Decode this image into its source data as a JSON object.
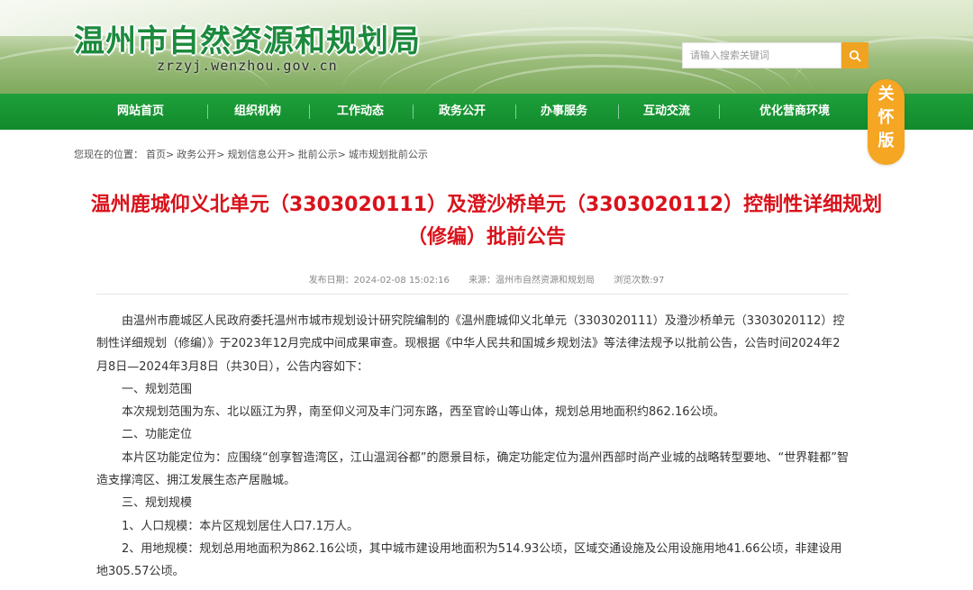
{
  "site": {
    "title": "温州市自然资源和规划局",
    "url": "zrzyj.wenzhou.gov.cn"
  },
  "search": {
    "placeholder": "请输入搜索关键词",
    "icon": "search-icon"
  },
  "nav": {
    "items": [
      "网站首页",
      "组织机构",
      "工作动态",
      "政务公开",
      "办事服务",
      "互动交流",
      "优化营商环境"
    ]
  },
  "care_mode": {
    "chars": [
      "关",
      "怀",
      "版"
    ]
  },
  "breadcrumb": {
    "prefix": "您现在的位置：",
    "items": [
      "首页>",
      "政务公开>",
      "规划信息公开>",
      "批前公示>",
      "城市规划批前公示"
    ]
  },
  "article": {
    "title": "温州鹿城仰义北单元（3303020111）及澄沙桥单元（3303020112）控制性详细规划（修编）批前公告",
    "meta": {
      "date": "发布日期：2024-02-08 15:02:16",
      "source": "来源：温州市自然资源和规划局",
      "views": "浏览次数:97"
    },
    "paragraphs": [
      "由温州市鹿城区人民政府委托温州市城市规划设计研究院编制的《温州鹿城仰义北单元（3303020111）及澄沙桥单元（3303020112）控制性详细规划（修编）》于2023年12月完成中间成果审查。现根据《中华人民共和国城乡规划法》等法律法规予以批前公告，公告时间2024年2月8日—2024年3月8日（共30日），公告内容如下：",
      "一、规划范围",
      "本次规划范围为东、北以瓯江为界，南至仰义河及丰门河东路，西至官岭山等山体，规划总用地面积约862.16公顷。",
      "二、功能定位",
      "本片区功能定位为：应围绕“创享智造湾区，江山温润谷都”的愿景目标，确定功能定位为温州西部时尚产业城的战略转型要地、“世界鞋都”智造支撑湾区、拥江发展生态产居融城。",
      "三、规划规模",
      "1、人口规模：本片区规划居住人口7.1万人。",
      "2、用地规模：规划总用地面积为862.16公顷，其中城市建设用地面积为514.93公顷，区域交通设施及公用设施用地41.66公顷，非建设用地305.57公顷。"
    ]
  },
  "colors": {
    "nav_green": "#1a9636",
    "title_red": "#d9121b",
    "accent_orange": "#f5a623"
  }
}
